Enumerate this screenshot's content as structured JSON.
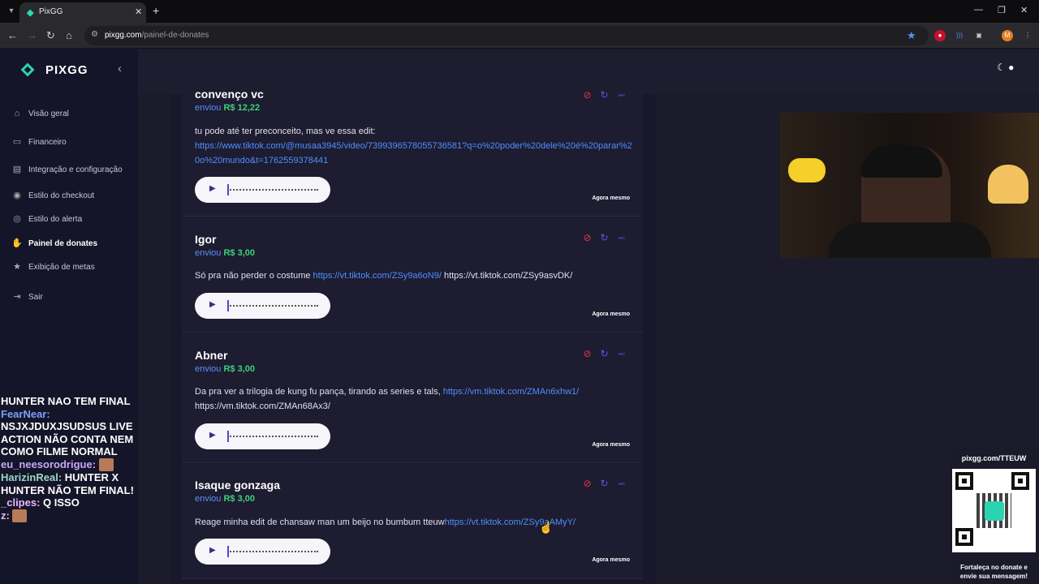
{
  "browser": {
    "tab_title": "PixGG",
    "url_host": "pixgg.com",
    "url_path": "/painel-de-donates",
    "profile_initial": "M"
  },
  "sidebar": {
    "logo": "PIXGG",
    "items": [
      {
        "label": "Visão geral",
        "icon": "home-icon"
      },
      {
        "label": "Financeiro",
        "icon": "wallet-icon"
      },
      {
        "label": "Integração e configuração",
        "icon": "settings-icon"
      },
      {
        "label": "Estilo do checkout",
        "icon": "palette-icon"
      },
      {
        "label": "Estilo do alerta",
        "icon": "bell-icon"
      },
      {
        "label": "Painel de donates",
        "icon": "hand-coins-icon"
      },
      {
        "label": "Exibição de metas",
        "icon": "star-icon"
      },
      {
        "label": "Sair",
        "icon": "logout-icon"
      }
    ]
  },
  "chat": [
    {
      "user": "",
      "text": "HUNTER NAO TEM FINAL"
    },
    {
      "user": "FearNear:",
      "text": ""
    },
    {
      "user": "",
      "text": "NSJXJDUXJSUDSUS LIVE ACTION NÃO CONTA NEM COMO FILME NORMAL"
    },
    {
      "user": "eu_neesorodrigue:",
      "text": ""
    },
    {
      "user": "HarizinReal:",
      "text": "HUNTER X HUNTER NÃO TEM FINAL!"
    },
    {
      "user": "_clipes:",
      "text": "Q ISSO"
    },
    {
      "user": "z:",
      "text": ""
    }
  ],
  "donations": [
    {
      "name": "convenço vc",
      "sent_label": "enviou",
      "amount": "R$ 12,22",
      "message_text": "tu pode até ter preconceito, mas ve essa edit:",
      "message_link": "https://www.tiktok.com/@musaa3945/video/7399396578055736581?q=o%20poder%20dele%20é%20parar%20o%20mundo&t=1762559378441",
      "message_link_2": "",
      "message_plain_after": "",
      "time": "Agora mesmo"
    },
    {
      "name": "Igor",
      "sent_label": "enviou",
      "amount": "R$ 3,00",
      "message_text": "Só pra não perder o costume",
      "message_link": "https://vt.tiktok.com/ZSy9a6oN9/",
      "message_plain_after": "https://vt.tiktok.com/ZSy9asvDK/",
      "time": "Agora mesmo"
    },
    {
      "name": "Abner",
      "sent_label": "enviou",
      "amount": "R$ 3,00",
      "message_text": "Da pra ver a trilogia de kung fu pança, tirando as series e tals,",
      "message_link": "https://vm.tiktok.com/ZMAn6xhw1/",
      "message_plain_after": "https://vm.tiktok.com/ZMAn68Ax3/",
      "time": "Agora mesmo"
    },
    {
      "name": "Isaque gonzaga",
      "sent_label": "enviou",
      "amount": "R$ 3,00",
      "message_text": "Reage minha edit de chansaw man um beijo no bumbum tteuw",
      "message_link": "https://vt.tiktok.com/ZSy9aAMyY/",
      "message_plain_after": "",
      "time": "Agora mesmo"
    }
  ],
  "qr": {
    "url": "pixgg.com/TTEUW",
    "caption_line1": "Fortaleça no donate e",
    "caption_line2": "envie sua mensagem!"
  }
}
